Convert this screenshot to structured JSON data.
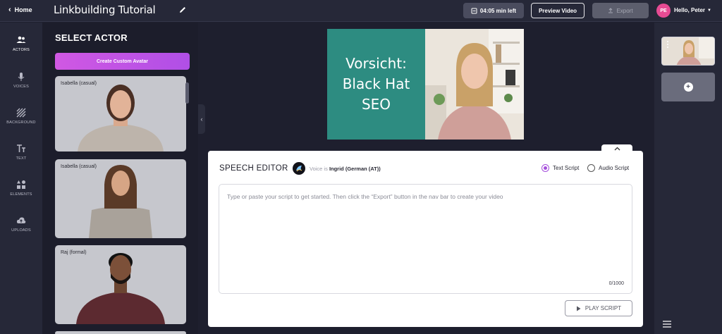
{
  "header": {
    "home_label": "Home",
    "project_title": "Linkbuilding Tutorial",
    "timer_label": "04:05 min left",
    "preview_label": "Preview Video",
    "export_label": "Export",
    "avatar_initials": "PE",
    "greeting": "Hello, Peter"
  },
  "sidebar": {
    "items": [
      {
        "label": "ACTORS",
        "icon": "people-icon"
      },
      {
        "label": "VOICES",
        "icon": "microphone-icon"
      },
      {
        "label": "BACKGROUND",
        "icon": "background-pattern-icon"
      },
      {
        "label": "TEXT",
        "icon": "text-icon"
      },
      {
        "label": "ELEMENTS",
        "icon": "shapes-icon"
      },
      {
        "label": "UPLOADS",
        "icon": "cloud-upload-icon"
      }
    ]
  },
  "actors": {
    "heading": "SELECT ACTOR",
    "create_label": "Create Custom Avatar",
    "cards": [
      {
        "name": "Isabella (casual)"
      },
      {
        "name": "Isabella (casual)"
      },
      {
        "name": "Raj (formal)"
      }
    ]
  },
  "stage": {
    "lines": [
      "Vorsicht:",
      "Black Hat",
      "SEO"
    ]
  },
  "editor": {
    "title": "SPEECH EDITOR",
    "voice_prefix": "Voice is ",
    "voice_name": "Ingrid (German (AT))",
    "options": [
      "Text Script",
      "Audio Script"
    ],
    "selected": "Text Script",
    "placeholder": "Type or paste your script to get started. Then click the “Export” button in the nav bar to create your video",
    "counter": "0/1000",
    "play_label": "PLAY SCRIPT"
  },
  "colors": {
    "accent": "#b04fe6",
    "stage_green": "#2d8c81",
    "avatar": "#e64b93"
  }
}
